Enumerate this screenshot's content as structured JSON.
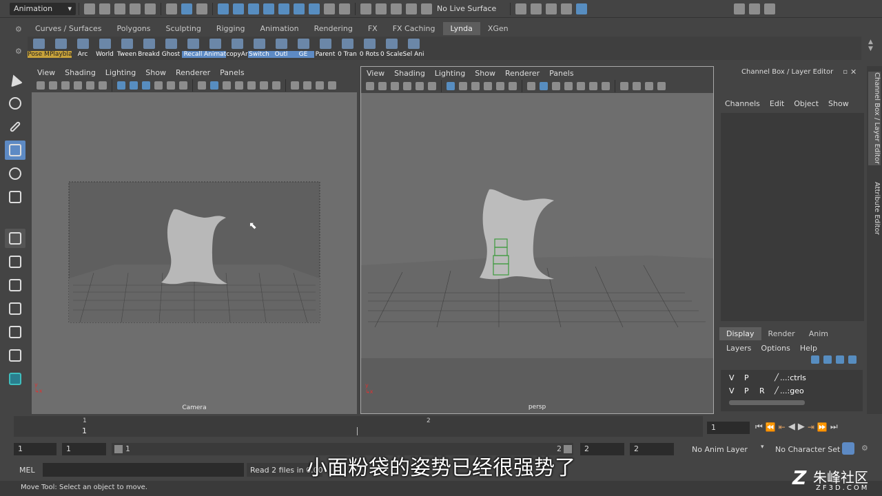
{
  "status_line": {
    "menu_set": "Animation",
    "live_surface": "No Live Surface"
  },
  "shelf": {
    "tabs": [
      "Curves / Surfaces",
      "Polygons",
      "Sculpting",
      "Rigging",
      "Animation",
      "Rendering",
      "FX",
      "FX Caching",
      "Lynda",
      "XGen"
    ],
    "active_tab": "Lynda",
    "buttons": [
      "Pose M",
      "Playbla",
      "Arc",
      "World",
      "Tween",
      "Breakd",
      "Ghost",
      "Recall",
      "Animat",
      "copyAr",
      "Switch",
      "Outl",
      "GE",
      "Parent",
      "0 Tran",
      "0 Rots",
      "0 Scale",
      "Sel Ani"
    ]
  },
  "panel_menu": [
    "View",
    "Shading",
    "Lighting",
    "Show",
    "Renderer",
    "Panels"
  ],
  "viewports": {
    "left_label": "Camera",
    "right_label": "persp"
  },
  "channel_box": {
    "title": "Channel Box / Layer Editor",
    "menu": [
      "Channels",
      "Edit",
      "Object",
      "Show"
    ],
    "layer_tabs": [
      "Display",
      "Render",
      "Anim"
    ],
    "active_layer_tab": "Display",
    "layer_menu": [
      "Layers",
      "Options",
      "Help"
    ],
    "layers": [
      {
        "v": "V",
        "p": "P",
        "r": "",
        "name": "...:ctrls"
      },
      {
        "v": "V",
        "p": "P",
        "r": "R",
        "name": "...:geo"
      }
    ]
  },
  "side_tabs": [
    "Channel Box / Layer Editor",
    "Attribute Editor"
  ],
  "time_slider": {
    "tick_1": "1",
    "tick_2": "2",
    "current_marker": "1",
    "current_frame": "1"
  },
  "range_slider": {
    "start": "1",
    "anim_start": "1",
    "range_start_label": "1",
    "range_end_label": "2",
    "anim_end": "2",
    "end": "2",
    "anim_layer": "No Anim Layer",
    "character_set": "No Character Set"
  },
  "command_line": {
    "type": "MEL",
    "result": "Read 2 files in 0.00"
  },
  "help_line": "Move Tool: Select an object to move.",
  "subtitle": "小面粉袋的姿势已经很强势了",
  "watermark": {
    "name": "朱峰社区",
    "url": "ZF3D.COM"
  },
  "colors": {
    "accent": "#5d8ac4",
    "viewport_bg": "#6e6e6e",
    "panel_bg": "#444444"
  }
}
